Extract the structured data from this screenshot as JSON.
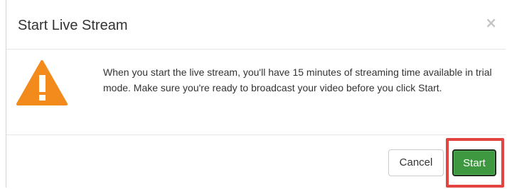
{
  "dialog": {
    "title": "Start Live Stream",
    "close_label": "×",
    "message": "When you start the live stream, you'll have 15 minutes of streaming time available in trial mode. Make sure you're ready to broadcast your video before you click Start.",
    "icon": "warning-triangle-icon",
    "icon_color": "#f38a1c"
  },
  "footer": {
    "cancel_label": "Cancel",
    "start_label": "Start",
    "start_color": "#3e9840",
    "highlight_color": "#e4443f"
  }
}
